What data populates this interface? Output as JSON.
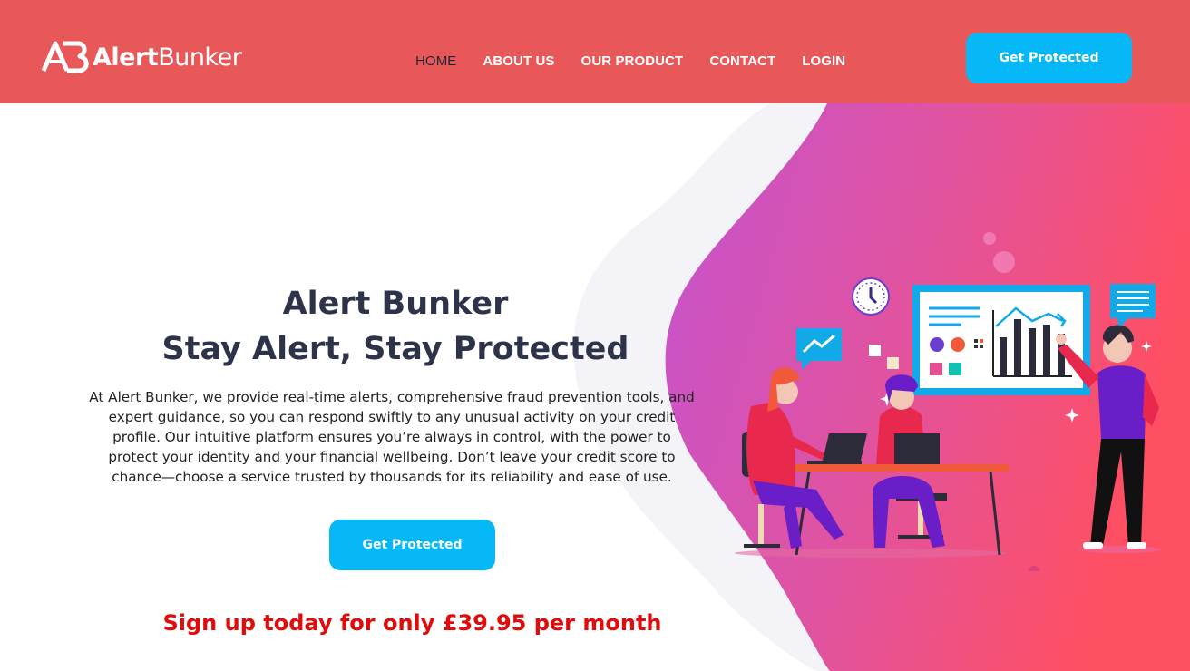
{
  "brand": {
    "name_part1": "Alert",
    "name_part2": "Bunker",
    "logo_icon": "ab-logo-icon"
  },
  "nav": {
    "items": [
      {
        "label": "HOME",
        "active": true
      },
      {
        "label": "ABOUT US",
        "active": false
      },
      {
        "label": "OUR PRODUCT",
        "active": false
      },
      {
        "label": "CONTACT",
        "active": false
      },
      {
        "label": "LOGIN",
        "active": false
      }
    ]
  },
  "header": {
    "cta_label": "Get Protected"
  },
  "hero": {
    "title_line1": "Alert Bunker",
    "title_line2": "Stay Alert, Stay Protected",
    "description": "At Alert Bunker, we provide real-time alerts, comprehensive fraud prevention tools, and expert guidance, so you can respond swiftly to any unusual activity on your credit profile. Our intuitive platform ensures you’re always in control, with the power to protect your identity and your financial wellbeing. Don’t leave your credit score to chance—choose a service trusted by thousands for its reliability and ease of use.",
    "cta_label": "Get Protected",
    "promo": "Sign up today for only £39.95 per month"
  },
  "colors": {
    "header_bg": "#e95858",
    "cta_bg": "#06b8f6",
    "title": "#2d3348",
    "promo": "#e00b0b",
    "blob_start": "#c84fd0",
    "blob_end": "#ff4f6a"
  },
  "illustration": {
    "icon": "team-analytics-illustration"
  }
}
